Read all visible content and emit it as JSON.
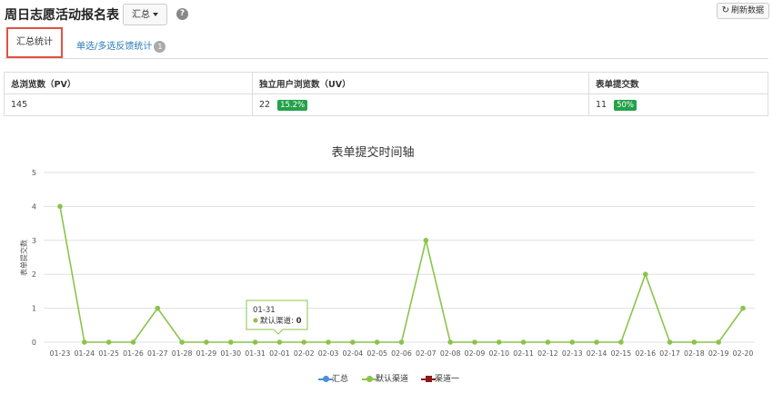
{
  "header": {
    "title": "周日志愿活动报名表",
    "dropdown_label": "汇总",
    "help_icon": "question-circle-icon",
    "refresh_label": "刷新数据"
  },
  "tabs": [
    {
      "label": "汇总统计",
      "active": true
    },
    {
      "label": "单选/多选反馈统计",
      "badge": "1"
    }
  ],
  "stats": {
    "pv_header": "总浏览数（PV）",
    "uv_header": "独立用户浏览数（UV）",
    "submit_header": "表单提交数",
    "pv_value": "145",
    "uv_value": "22",
    "uv_pct": "15.2%",
    "submit_value": "11",
    "submit_pct": "50%"
  },
  "tooltip": {
    "date": "01-31",
    "series": "默认渠道",
    "value": "0"
  },
  "colors": {
    "accent": "#8bc34a",
    "series_total": "#4a90d9",
    "series_default": "#8bc34a",
    "series_channel1": "#8b1a1a",
    "badge_green": "#24a14a",
    "active_tab_border": "#e0533f"
  },
  "chart_data": {
    "type": "line",
    "title": "表单提交时间轴",
    "ylabel": "表单提交数",
    "xlabel": "",
    "ylim": [
      0,
      5
    ],
    "yticks": [
      0,
      1,
      2,
      3,
      4,
      5
    ],
    "grid": true,
    "legend_position": "bottom",
    "x": [
      "01-23",
      "01-24",
      "01-25",
      "01-26",
      "01-27",
      "01-28",
      "01-29",
      "01-30",
      "01-31",
      "02-01",
      "02-02",
      "02-03",
      "02-04",
      "02-05",
      "02-06",
      "02-07",
      "02-08",
      "02-09",
      "02-10",
      "02-11",
      "02-12",
      "02-13",
      "02-14",
      "02-15",
      "02-16",
      "02-17",
      "02-18",
      "02-19",
      "02-20"
    ],
    "series": [
      {
        "name": "汇总",
        "values": [],
        "color": "#4a90d9"
      },
      {
        "name": "默认渠道",
        "values": [
          4,
          0,
          0,
          0,
          1,
          0,
          0,
          0,
          0,
          0,
          0,
          0,
          0,
          0,
          0,
          3,
          0,
          0,
          0,
          0,
          0,
          0,
          0,
          0,
          2,
          0,
          0,
          0,
          1
        ],
        "color": "#8bc34a"
      },
      {
        "name": "渠道一",
        "values": [],
        "color": "#8b1a1a"
      }
    ]
  }
}
